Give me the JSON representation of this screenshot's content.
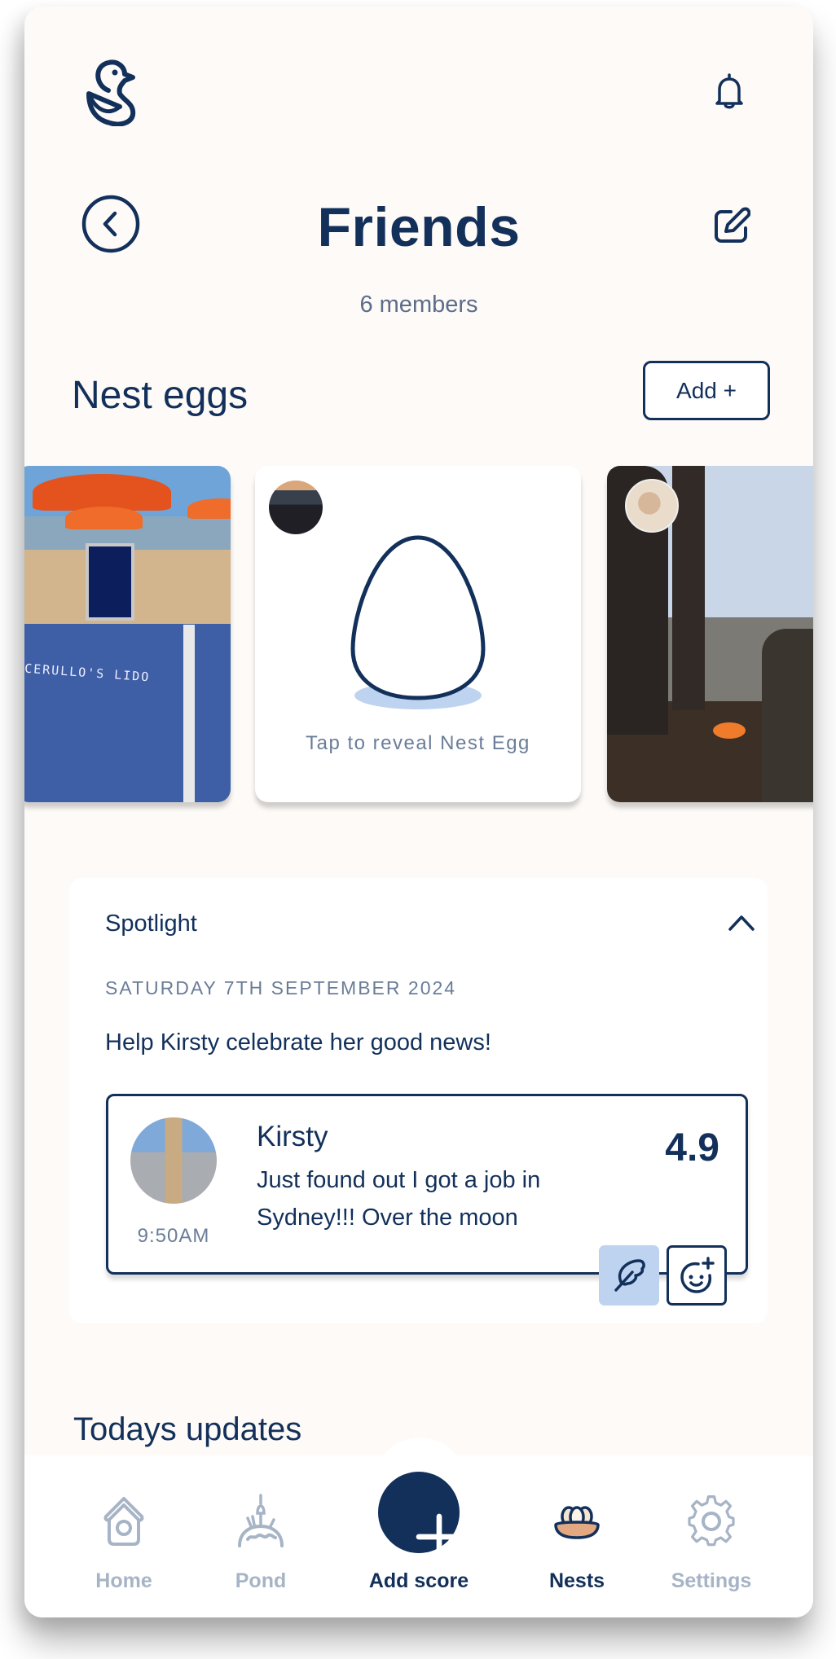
{
  "header": {
    "logo": "duck-logo-icon",
    "notifications_icon": "bell-icon",
    "back_icon": "chevron-left-circle-icon",
    "edit_icon": "edit-icon",
    "title": "Friends",
    "members": "6 members"
  },
  "nest_eggs": {
    "title": "Nest eggs",
    "add_label": "Add +",
    "cards": [
      {
        "type": "photo",
        "description": "Beach with orange umbrellas and blue deck chairs",
        "photo_text": "CERULLO'S LIDO"
      },
      {
        "type": "hidden",
        "caption": "Tap to reveal Nest Egg"
      },
      {
        "type": "photo",
        "description": "Park with trees, palms and a barbecue fire"
      }
    ]
  },
  "spotlight": {
    "title": "Spotlight",
    "date": "SATURDAY 7TH SEPTEMBER 2024",
    "prompt": "Help Kirsty celebrate her good news!",
    "post": {
      "name": "Kirsty",
      "message": "Just found out I got a job in Sydney!!! Over the moon",
      "time": "9:50AM",
      "score": "4.9"
    },
    "reactions": [
      {
        "icon": "feather-icon",
        "active": true
      },
      {
        "icon": "add-emoji-icon",
        "active": false
      }
    ]
  },
  "updates": {
    "title": "Todays updates"
  },
  "nav": {
    "items": [
      {
        "label": "Home",
        "icon": "birdhouse-icon",
        "active": false
      },
      {
        "label": "Pond",
        "icon": "pond-icon",
        "active": false
      },
      {
        "label": "Add score",
        "icon": "plus-icon",
        "active": false
      },
      {
        "label": "Nests",
        "icon": "nest-icon",
        "active": true
      },
      {
        "label": "Settings",
        "icon": "gear-icon",
        "active": false
      }
    ]
  },
  "colors": {
    "primary": "#12305a",
    "background": "#fdfaf7",
    "muted": "#6a7d98",
    "nav_inactive": "#a6b4c6",
    "accent_light": "#bed3f0",
    "nest_fill": "#e2a882"
  }
}
